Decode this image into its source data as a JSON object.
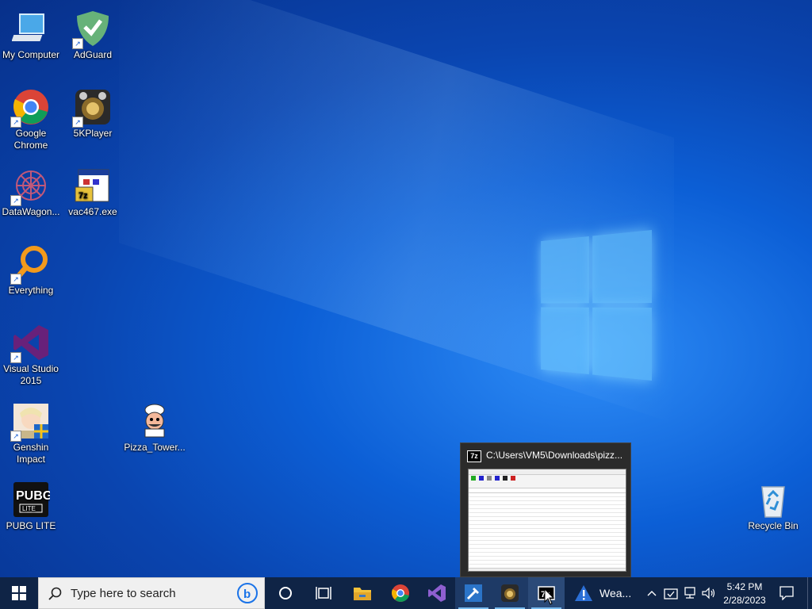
{
  "desktop_icons": [
    {
      "label": "My Computer",
      "icon": "computer-icon"
    },
    {
      "label": "AdGuard",
      "icon": "adguard-icon"
    },
    {
      "label": "Google Chrome",
      "icon": "chrome-icon"
    },
    {
      "label": "5KPlayer",
      "icon": "5kplayer-icon"
    },
    {
      "label": "DataWagon...",
      "icon": "datawagon-icon"
    },
    {
      "label": "vac467.exe",
      "icon": "vac467-icon"
    },
    {
      "label": "Everything",
      "icon": "everything-icon"
    },
    {
      "label": "Visual Studio 2015",
      "icon": "visual-studio-icon"
    },
    {
      "label": "Genshin Impact",
      "icon": "genshin-icon"
    },
    {
      "label": "Pizza_Tower...",
      "icon": "pizza-tower-icon"
    },
    {
      "label": "PUBG LITE",
      "icon": "pubg-icon"
    },
    {
      "label": "Recycle Bin",
      "icon": "recycle-bin-icon"
    }
  ],
  "preview": {
    "title": "C:\\Users\\VM5\\Downloads\\pizz...",
    "app_badge": "7z"
  },
  "taskbar": {
    "search_placeholder": "Type here to search",
    "weather_label": "Wea...",
    "time": "5:42 PM",
    "date": "2/28/2023"
  },
  "colors": {
    "taskbar": "#0f2446",
    "accent": "#76b9ed",
    "desktop": "#0a5bd8"
  }
}
